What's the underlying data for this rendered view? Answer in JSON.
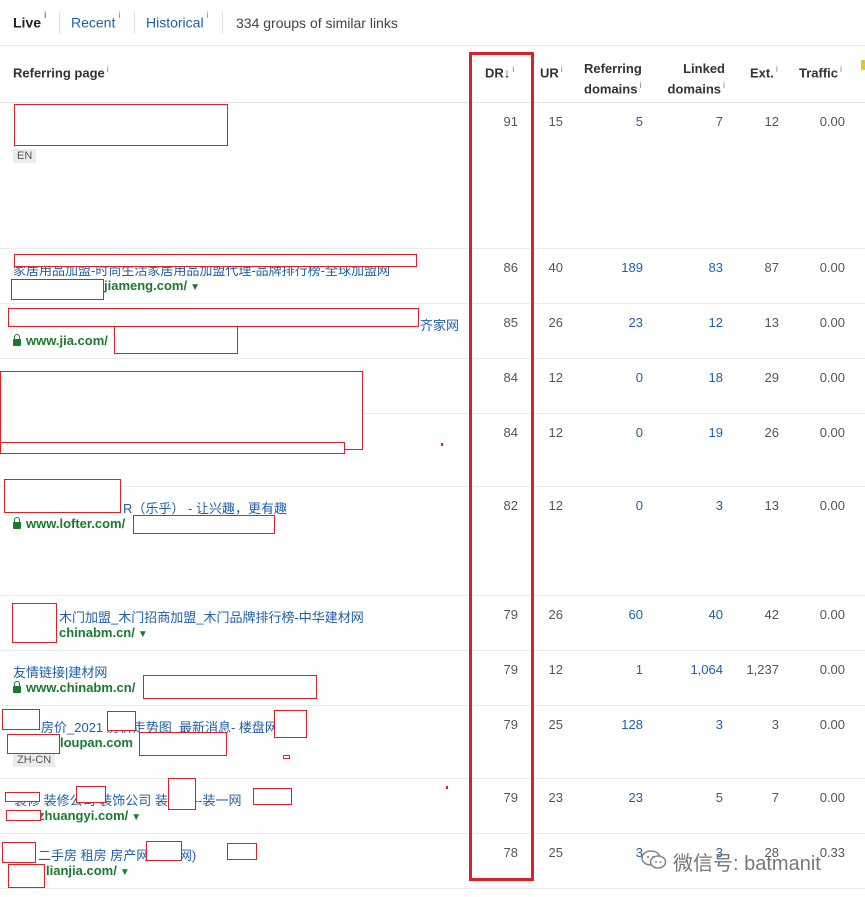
{
  "tabs": {
    "live": "Live",
    "recent": "Recent",
    "historical": "Historical",
    "info_mark": "i",
    "groups_summary": "334 groups of similar links"
  },
  "headers": {
    "referring_page": "Referring page",
    "dr": "DR↓",
    "ur": "UR",
    "referring_domains_1": "Referring",
    "referring_domains_2": "domains",
    "linked_domains_1": "Linked",
    "linked_domains_2": "domains",
    "ext": "Ext.",
    "traffic": "Traffic",
    "info_mark": "i"
  },
  "rows": [
    {
      "title": "",
      "url": "",
      "lang": "EN",
      "dr": "91",
      "ur": "15",
      "rd": "5",
      "ld": "7",
      "ext": "12",
      "traffic": "0.00"
    },
    {
      "title": "家居用品加盟-时尚生活家居用品加盟代理-品牌排行榜-全球加盟网",
      "url": "jiameng.com/",
      "lang": "",
      "dr": "86",
      "ur": "40",
      "rd": "189",
      "ld": "83",
      "ext": "87",
      "traffic": "0.00"
    },
    {
      "title": "齐家网",
      "url": "www.jia.com/",
      "lang": "",
      "dr": "85",
      "ur": "26",
      "rd": "23",
      "ld": "12",
      "ext": "13",
      "traffic": "0.00"
    },
    {
      "title": "",
      "url": "",
      "lang": "",
      "dr": "84",
      "ur": "12",
      "rd": "0",
      "ld": "18",
      "ext": "29",
      "traffic": "0.00"
    },
    {
      "title": "",
      "url": "",
      "lang": "",
      "dr": "84",
      "ur": "12",
      "rd": "0",
      "ld": "19",
      "ext": "26",
      "traffic": "0.00"
    },
    {
      "title": "R（乐乎） - 让兴趣，更有趣",
      "url": "www.lofter.com/",
      "lang": "",
      "dr": "82",
      "ur": "12",
      "rd": "0",
      "ld": "3",
      "ext": "13",
      "traffic": "0.00"
    },
    {
      "title": "木门加盟_木门招商加盟_木门品牌排行榜-中华建材网",
      "url": "chinabm.cn/",
      "lang": "",
      "dr": "79",
      "ur": "26",
      "rd": "60",
      "ld": "40",
      "ext": "42",
      "traffic": "0.00"
    },
    {
      "title": "友情链接|建材网",
      "url": "www.chinabm.cn/",
      "lang": "",
      "dr": "79",
      "ur": "12",
      "rd": "1",
      "ld": "1,064",
      "ext": "1,237",
      "traffic": "0.00"
    },
    {
      "title": "房价_2021 房价走势图_最新消息- 楼盘网",
      "url": "loupan.com",
      "lang": "ZH-CN",
      "dr": "79",
      "ur": "25",
      "rd": "128",
      "ld": "3",
      "ext": "3",
      "traffic": "0.00"
    },
    {
      "title": "装修 装修公司 装饰公司 装修网--装一网",
      "url": "zhuangyi.com/",
      "lang": "",
      "dr": "79",
      "ur": "23",
      "rd": "23",
      "ld": "5",
      "ext": "7",
      "traffic": "0.00"
    },
    {
      "title": "二手房 租房 房产网 链家网)",
      "url": "lianjia.com/",
      "lang": "",
      "dr": "78",
      "ur": "25",
      "rd": "3",
      "ld": "3",
      "ext": "28",
      "traffic": "0.33"
    }
  ],
  "watermark": {
    "text": "微信号: batmanit",
    "icon": "wechat-icon"
  },
  "colors": {
    "link_blue": "#1f5fa8",
    "url_green": "#1a7a2e",
    "annotation_red": "#d8222a"
  }
}
